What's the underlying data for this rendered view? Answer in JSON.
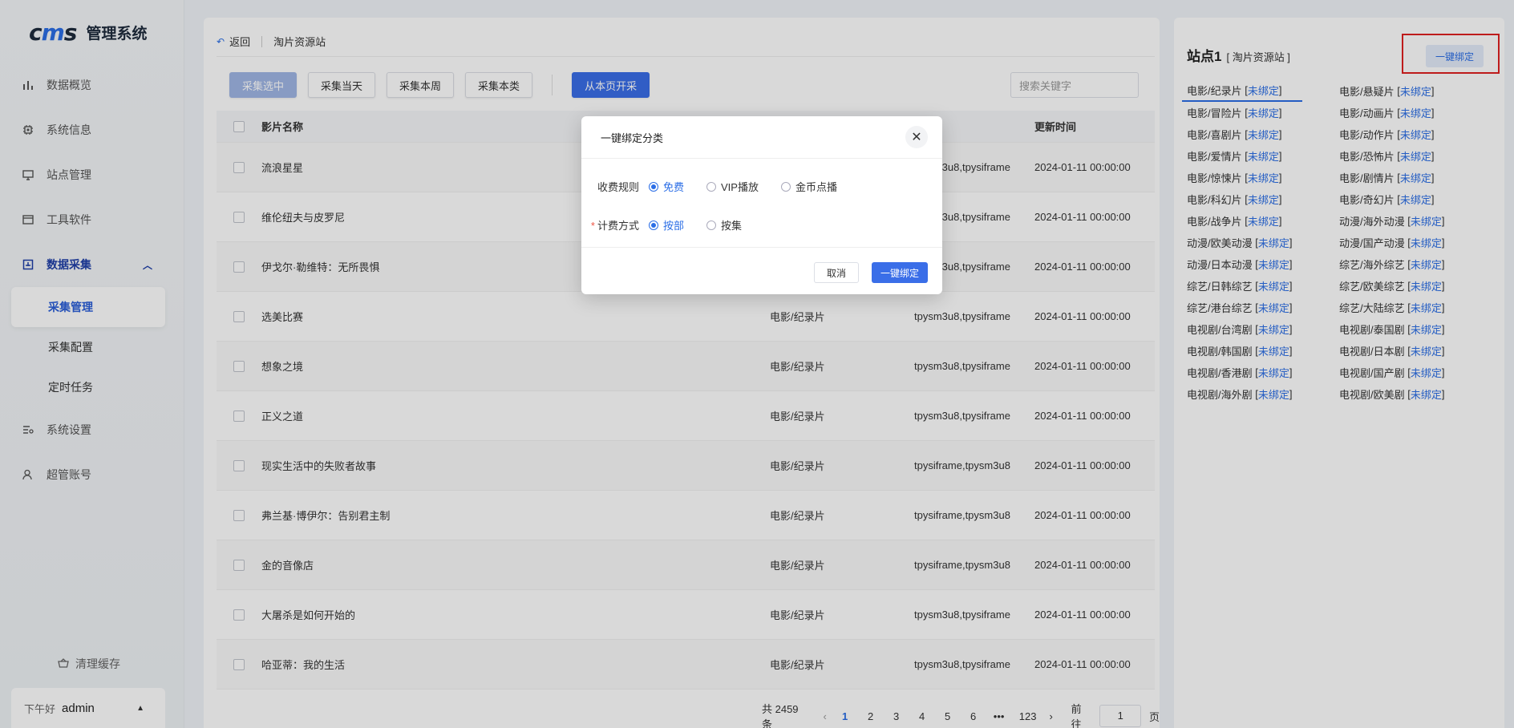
{
  "app": {
    "logo_mark_a": "c",
    "logo_mark_b": "m",
    "logo_mark_c": "s",
    "title": "管理系统"
  },
  "nav": {
    "items": [
      {
        "label": "数据概览",
        "icon": "bar-chart-icon"
      },
      {
        "label": "系统信息",
        "icon": "chip-icon"
      },
      {
        "label": "站点管理",
        "icon": "monitor-icon"
      },
      {
        "label": "工具软件",
        "icon": "window-icon"
      },
      {
        "label": "数据采集",
        "icon": "collect-icon"
      }
    ],
    "sub_items": [
      "采集管理",
      "采集配置",
      "定时任务"
    ],
    "items_after": [
      {
        "label": "系统设置",
        "icon": "settings-list-icon"
      },
      {
        "label": "超管账号",
        "icon": "user-icon"
      }
    ],
    "clear_cache": "清理缓存",
    "greet": "下午好",
    "user": "admin"
  },
  "breadcrumb": {
    "back": "返回",
    "current": "淘片资源站"
  },
  "toolbar": {
    "collect_selected": "采集选中",
    "collect_today": "采集当天",
    "collect_week": "采集本周",
    "collect_category": "采集本类",
    "collect_from_page": "从本页开采",
    "search_placeholder": "搜索关键字"
  },
  "table": {
    "headers": {
      "name": "影片名称",
      "category": "",
      "source": "",
      "time": "更新时间"
    },
    "rows": [
      {
        "name": "流浪星星",
        "category": "",
        "source": "tpysm3u8,tpysiframe",
        "time": "2024-01-11 00:00:00"
      },
      {
        "name": "维伦纽夫与皮罗尼",
        "category": "",
        "source": "tpysm3u8,tpysiframe",
        "time": "2024-01-11 00:00:00"
      },
      {
        "name": "伊戈尔·勒维特：无所畏惧",
        "category": "",
        "source": "tpysm3u8,tpysiframe",
        "time": "2024-01-11 00:00:00"
      },
      {
        "name": "选美比赛",
        "category": "电影/纪录片",
        "source": "tpysm3u8,tpysiframe",
        "time": "2024-01-11 00:00:00"
      },
      {
        "name": "想象之境",
        "category": "电影/纪录片",
        "source": "tpysm3u8,tpysiframe",
        "time": "2024-01-11 00:00:00"
      },
      {
        "name": "正义之道",
        "category": "电影/纪录片",
        "source": "tpysm3u8,tpysiframe",
        "time": "2024-01-11 00:00:00"
      },
      {
        "name": "现实生活中的失败者故事",
        "category": "电影/纪录片",
        "source": "tpysiframe,tpysm3u8",
        "time": "2024-01-11 00:00:00"
      },
      {
        "name": "弗兰基·博伊尔：告别君主制",
        "category": "电影/纪录片",
        "source": "tpysiframe,tpysm3u8",
        "time": "2024-01-11 00:00:00"
      },
      {
        "name": "金的音像店",
        "category": "电影/纪录片",
        "source": "tpysiframe,tpysm3u8",
        "time": "2024-01-11 00:00:00"
      },
      {
        "name": "大屠杀是如何开始的",
        "category": "电影/纪录片",
        "source": "tpysm3u8,tpysiframe",
        "time": "2024-01-11 00:00:00"
      },
      {
        "name": "哈亚蒂：我的生活",
        "category": "电影/纪录片",
        "source": "tpysm3u8,tpysiframe",
        "time": "2024-01-11 00:00:00"
      }
    ]
  },
  "pager": {
    "total": "共 2459 条",
    "prev": "‹",
    "pages": [
      "1",
      "2",
      "3",
      "4",
      "5",
      "6",
      "•••",
      "123"
    ],
    "next": "›",
    "goto": "前往",
    "goto_value": "1",
    "page_unit": "页"
  },
  "right": {
    "title": "站点1",
    "subtitle": "[ 淘片资源站 ]",
    "bind_all": "一键绑定",
    "unbound": "未绑定",
    "categories": [
      "电影/纪录片",
      "电影/悬疑片",
      "电影/冒险片",
      "电影/动画片",
      "电影/喜剧片",
      "电影/动作片",
      "电影/爱情片",
      "电影/恐怖片",
      "电影/惊悚片",
      "电影/剧情片",
      "电影/科幻片",
      "电影/奇幻片",
      "电影/战争片",
      "动漫/海外动漫",
      "动漫/欧美动漫",
      "动漫/国产动漫",
      "动漫/日本动漫",
      "综艺/海外综艺",
      "综艺/日韩综艺",
      "综艺/欧美综艺",
      "综艺/港台综艺",
      "综艺/大陆综艺",
      "电视剧/台湾剧",
      "电视剧/泰国剧",
      "电视剧/韩国剧",
      "电视剧/日本剧",
      "电视剧/香港剧",
      "电视剧/国产剧",
      "电视剧/海外剧",
      "电视剧/欧美剧"
    ]
  },
  "modal": {
    "title": "一键绑定分类",
    "close": "✕",
    "fee_label": "收费规则",
    "fee_options": [
      "免费",
      "VIP播放",
      "金币点播"
    ],
    "bill_label": "计费方式",
    "bill_options": [
      "按部",
      "按集"
    ],
    "cancel": "取消",
    "ok": "一键绑定"
  },
  "colors": {
    "accent": "#3a6ee8",
    "highlight_frame": "#e02020"
  }
}
